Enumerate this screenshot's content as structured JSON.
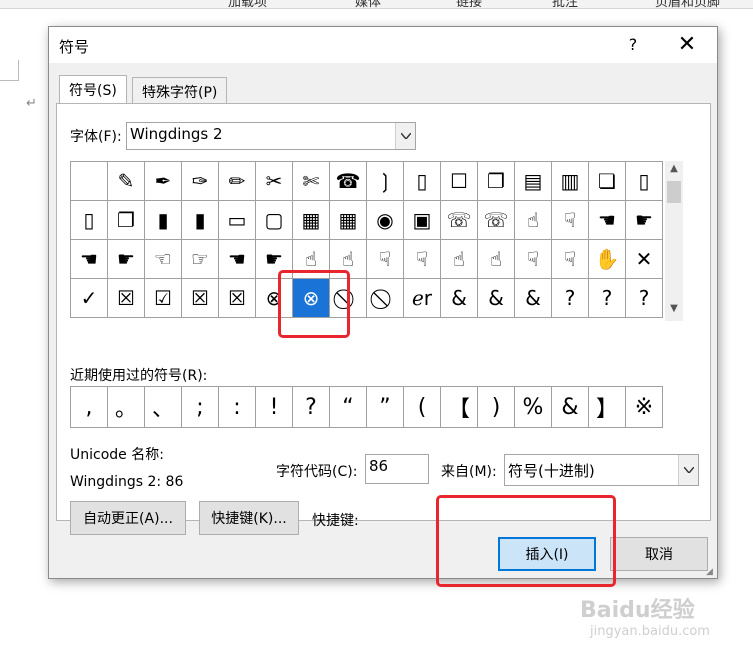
{
  "ribbon": {
    "items": [
      "加载项",
      "媒体",
      "链接",
      "批注",
      "页眉和页脚"
    ]
  },
  "document": {
    "paragraph_mark": "↵"
  },
  "dialog": {
    "title": "符号",
    "help_label": "?",
    "close_label": "✕",
    "tabs": [
      {
        "label": "符号(S)",
        "active": true
      },
      {
        "label": "特殊字符(P)",
        "active": false
      }
    ],
    "font_label": "字体(F):",
    "font_value": "Wingdings 2",
    "symbol_grid": [
      [
        " ",
        "✎",
        "✒",
        "✑",
        "✏",
        "✂",
        "✄",
        "☎",
        "❳",
        "▯",
        "☐",
        "❐",
        "▤",
        "▥",
        "❏",
        "▯"
      ],
      [
        "▯",
        "❐",
        "▮",
        "▮",
        "▭",
        "▢",
        "▦",
        "▦",
        "◉",
        "▣",
        "☏",
        "☏",
        "☝",
        "☟",
        "☚",
        "☛"
      ],
      [
        "☚",
        "☛",
        "☜",
        "☞",
        "☚",
        "☛",
        "☝",
        "☝",
        "☟",
        "☟",
        "☝",
        "☝",
        "☟",
        "☟",
        "✋",
        "✕"
      ],
      [
        "✓",
        "☒",
        "☑",
        "☒",
        "☒",
        "⊗",
        "⊗",
        "⃠",
        "⃠",
        "ℯr",
        "&",
        "&",
        "&",
        "?",
        "?",
        "?"
      ]
    ],
    "selected_symbol": "⊗",
    "recent_label": "近期使用过的符号(R):",
    "recent_symbols": [
      ",",
      "。",
      "、",
      ";",
      ":",
      "!",
      "?",
      "“",
      "”",
      "(",
      "【",
      ")",
      "%",
      "&",
      "】",
      "※"
    ],
    "unicode_name_label": "Unicode 名称:",
    "unicode_name_value": "Wingdings 2: 86",
    "char_code_label": "字符代码(C):",
    "char_code_value": "86",
    "from_label": "来自(M):",
    "from_value": "符号(十进制)",
    "autocorrect_button": "自动更正(A)...",
    "shortcut_button": "快捷键(K)...",
    "shortcut_label": "快捷键:",
    "insert_button": "插入(I)",
    "cancel_button": "取消"
  },
  "watermark": {
    "text": "Baidu经验",
    "url_text": "jingyan.baidu.com"
  },
  "colors": {
    "highlight": "#e8262e",
    "selection": "#1a73d6",
    "primary_border": "#0078d7"
  }
}
